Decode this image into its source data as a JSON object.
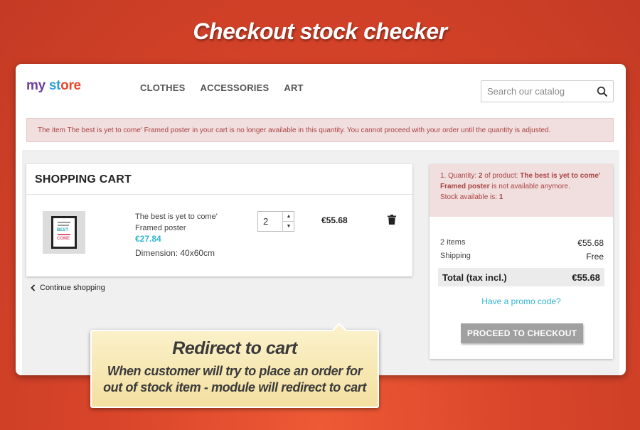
{
  "hero": {
    "title": "Checkout stock checker"
  },
  "header": {
    "logo": {
      "part1": "my",
      "part2": " st",
      "part3": "ore"
    },
    "nav": [
      "CLOTHES",
      "ACCESSORIES",
      "ART"
    ],
    "search_placeholder": "Search our catalog"
  },
  "alert": {
    "message": "The item The best is yet to come' Framed poster in your cart is no longer available in this quantity. You cannot proceed with your order until the quantity is adjusted."
  },
  "cart": {
    "title": "SHOPPING CART",
    "product": {
      "name": "The best is yet to come' Framed poster",
      "price": "€27.84",
      "dimension": "Dimension: 40x60cm",
      "quantity": "2",
      "line_total": "€55.68",
      "poster_best": "BEST",
      "poster_come": "COME"
    },
    "continue_label": "Continue shopping"
  },
  "summary": {
    "alert_prefix": "1. Quantity: ",
    "alert_qty": "2",
    "alert_mid": " of product: ",
    "alert_product": "The best is yet to come' Framed poster",
    "alert_suffix": " is not available anymore.",
    "alert_stock_label": "Stock available is: ",
    "alert_stock": "1",
    "items_label": "2 items",
    "items_value": "€55.68",
    "shipping_label": "Shipping",
    "shipping_value": "Free",
    "total_label": "Total (tax incl.)",
    "total_value": "€55.68",
    "promo": "Have a promo code?",
    "checkout_label": "PROCEED TO CHECKOUT"
  },
  "callout": {
    "title": "Redirect to cart",
    "line1": "When customer will try to place an order for",
    "line2": "out of stock item - module will redirect to cart"
  },
  "colors": {
    "accent": "#2fb5d2",
    "alert_bg": "#f1dede",
    "alert_text": "#a94442",
    "background": "#d9452a"
  }
}
